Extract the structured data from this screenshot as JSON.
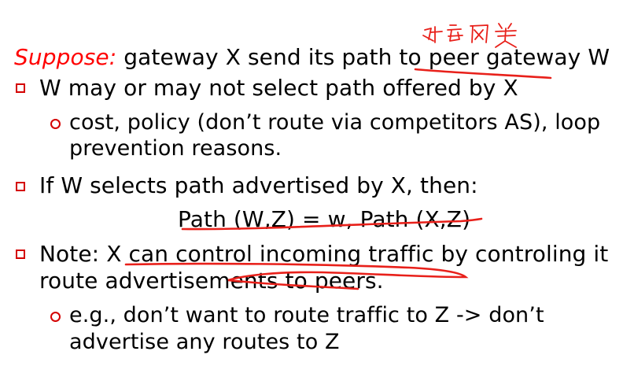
{
  "slide": {
    "intro": {
      "label": "Suppose:",
      "text": " gateway X send its path to peer gateway W"
    },
    "items": [
      {
        "text": "W may or may not select path offered by X",
        "subitems": [
          {
            "line1": "cost, policy (don’t route via competitors AS), loop",
            "line2": "prevention reasons."
          }
        ]
      },
      {
        "text": "If W selects path advertised by X, then:",
        "formula": "Path (W,Z) = w, Path (X,Z)"
      },
      {
        "line1": "Note: X can control incoming traffic by controling it",
        "line2": "route advertisements to peers.",
        "subitems": [
          {
            "line1": "e.g., don’t want to route traffic to Z -> don’t",
            "line2": "advertise any routes to Z"
          }
        ]
      }
    ],
    "handwritten_note": "对等网关",
    "colors": {
      "text": "#000000",
      "label": "#ff0000",
      "bullet": "#d40000",
      "ink": "#e8201a"
    }
  }
}
